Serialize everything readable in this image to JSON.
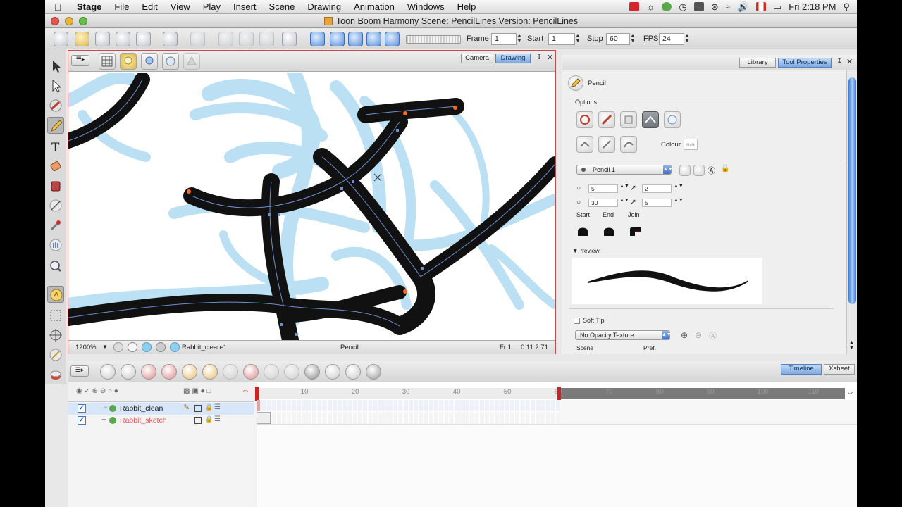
{
  "menubar": {
    "app_name": "Stage",
    "items": [
      "File",
      "Edit",
      "View",
      "Play",
      "Insert",
      "Scene",
      "Drawing",
      "Animation",
      "Windows",
      "Help"
    ],
    "clock": "Fri 2:18 PM"
  },
  "window": {
    "title": "Toon Boom Harmony Scene: PencilLines Version: PencilLines"
  },
  "playback": {
    "frame_label": "Frame",
    "frame_value": "1",
    "start_label": "Start",
    "start_value": "1",
    "stop_label": "Stop",
    "stop_value": "60",
    "fps_label": "FPS",
    "fps_value": "24"
  },
  "camera_view": {
    "tabs": [
      "Camera",
      "Drawing"
    ],
    "selected_tab": "Drawing",
    "zoom": "1200%",
    "drawing_name": "Rabbit_clean-1",
    "tool_name": "Pencil",
    "frame": "Fr 1",
    "coords": "0.11:2.71"
  },
  "tool_properties": {
    "tabs": [
      "Library",
      "Tool Properties"
    ],
    "selected_tab": "Tool Properties",
    "tool_title": "Pencil",
    "options_label": "Options",
    "colour_label": "Colour",
    "colour_value": "n/a",
    "preset": "Pencil 1",
    "min_size": "5",
    "max_size": "2",
    "smoothing": "30",
    "contour": "5",
    "start_label": "Start",
    "end_label": "End",
    "join_label": "Join",
    "preview_label": "Preview",
    "soft_tip_label": "Soft Tip",
    "texture": "No Opacity Texture",
    "scene_label": "Scene",
    "pref_label": "Pref."
  },
  "timeline": {
    "tabs": [
      "Timeline",
      "Xsheet"
    ],
    "selected_tab": "Timeline",
    "layers": [
      {
        "name": "Rabbit_clean",
        "color": "#1a1a1a",
        "checked": true
      },
      {
        "name": "Rabbit_sketch",
        "color": "#e05a5a",
        "checked": true
      }
    ],
    "ruler_numbers": [
      "10",
      "20",
      "30",
      "40",
      "50",
      "60",
      "70",
      "80",
      "90",
      "100",
      "110"
    ],
    "stop_frame": 60
  },
  "colors": {
    "accent_blue": "#5b8fdc",
    "camera_border": "#c84b4b",
    "sketch_blue": "#7fc2e8"
  }
}
